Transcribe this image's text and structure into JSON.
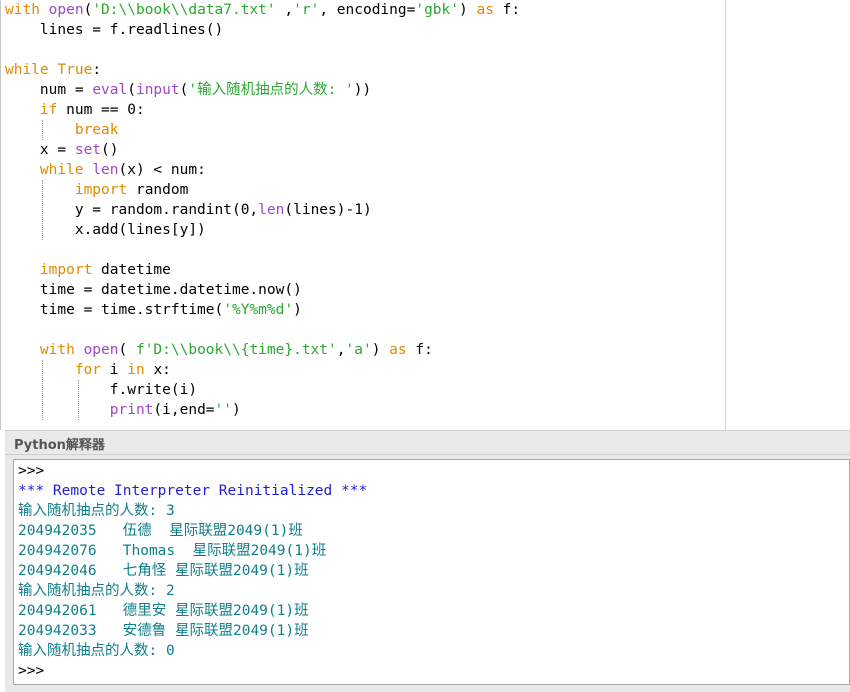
{
  "editor": {
    "lines": [
      {
        "segments": [
          {
            "t": "with",
            "c": "kw"
          },
          {
            "t": " "
          },
          {
            "t": "open",
            "c": "bi"
          },
          {
            "t": "("
          },
          {
            "t": "'D:\\\\book\\\\data7.txt'",
            "c": "str"
          },
          {
            "t": " ,"
          },
          {
            "t": "'r'",
            "c": "str"
          },
          {
            "t": ", encoding="
          },
          {
            "t": "'gbk'",
            "c": "str"
          },
          {
            "t": ") "
          },
          {
            "t": "as",
            "c": "kw"
          },
          {
            "t": " f:"
          }
        ]
      },
      {
        "segments": [
          {
            "t": "    lines = f.readlines()"
          }
        ]
      },
      {
        "segments": [
          {
            "t": ""
          }
        ]
      },
      {
        "segments": [
          {
            "t": "while",
            "c": "kw"
          },
          {
            "t": " "
          },
          {
            "t": "True",
            "c": "kw"
          },
          {
            "t": ":"
          }
        ]
      },
      {
        "segments": [
          {
            "t": "    num = "
          },
          {
            "t": "eval",
            "c": "bi"
          },
          {
            "t": "("
          },
          {
            "t": "input",
            "c": "bi"
          },
          {
            "t": "("
          },
          {
            "t": "'输入随机抽点的人数: '",
            "c": "str"
          },
          {
            "t": "))"
          }
        ]
      },
      {
        "segments": [
          {
            "t": "    "
          },
          {
            "t": "if",
            "c": "kw"
          },
          {
            "t": " num == 0:"
          }
        ]
      },
      {
        "segments": [
          {
            "t": "        "
          },
          {
            "t": "break",
            "c": "kw"
          }
        ]
      },
      {
        "segments": [
          {
            "t": "    x = "
          },
          {
            "t": "set",
            "c": "bi"
          },
          {
            "t": "()"
          }
        ]
      },
      {
        "segments": [
          {
            "t": "    "
          },
          {
            "t": "while",
            "c": "kw"
          },
          {
            "t": " "
          },
          {
            "t": "len",
            "c": "bi"
          },
          {
            "t": "(x) < num:"
          }
        ]
      },
      {
        "segments": [
          {
            "t": "        "
          },
          {
            "t": "import",
            "c": "kw"
          },
          {
            "t": " random"
          }
        ]
      },
      {
        "segments": [
          {
            "t": "        y = random.randint(0,"
          },
          {
            "t": "len",
            "c": "bi"
          },
          {
            "t": "(lines)-1)"
          }
        ]
      },
      {
        "segments": [
          {
            "t": "        x.add(lines[y])"
          }
        ]
      },
      {
        "segments": [
          {
            "t": ""
          }
        ]
      },
      {
        "segments": [
          {
            "t": "    "
          },
          {
            "t": "import",
            "c": "kw"
          },
          {
            "t": " datetime"
          }
        ]
      },
      {
        "segments": [
          {
            "t": "    time = datetime.datetime.now()"
          }
        ]
      },
      {
        "segments": [
          {
            "t": "    time = time.strftime("
          },
          {
            "t": "'%Y%m%d'",
            "c": "str"
          },
          {
            "t": ")"
          }
        ]
      },
      {
        "segments": [
          {
            "t": ""
          }
        ]
      },
      {
        "segments": [
          {
            "t": "    "
          },
          {
            "t": "with",
            "c": "kw"
          },
          {
            "t": " "
          },
          {
            "t": "open",
            "c": "bi"
          },
          {
            "t": "( "
          },
          {
            "t": "f'D:\\\\book\\\\{time}.txt'",
            "c": "str"
          },
          {
            "t": ","
          },
          {
            "t": "'a'",
            "c": "str"
          },
          {
            "t": ") "
          },
          {
            "t": "as",
            "c": "kw"
          },
          {
            "t": " f:"
          }
        ]
      },
      {
        "segments": [
          {
            "t": "        "
          },
          {
            "t": "for",
            "c": "kw"
          },
          {
            "t": " i "
          },
          {
            "t": "in",
            "c": "kw"
          },
          {
            "t": " x:"
          }
        ]
      },
      {
        "segments": [
          {
            "t": "            f.write(i)"
          }
        ]
      },
      {
        "segments": [
          {
            "t": "            "
          },
          {
            "t": "print",
            "c": "bi"
          },
          {
            "t": "(i,end="
          },
          {
            "t": "''",
            "c": "str"
          },
          {
            "t": ")"
          }
        ]
      }
    ]
  },
  "interpreter": {
    "title": "Python解释器",
    "lines": [
      {
        "text": ">>>",
        "style": "prompt"
      },
      {
        "text": "*** Remote Interpreter Reinitialized ***",
        "style": "blue"
      },
      {
        "text": "输入随机抽点的人数: 3",
        "style": "teal"
      },
      {
        "text": "204942035   伍德  星际联盟2049(1)班",
        "style": "teal"
      },
      {
        "text": "204942076   Thomas  星际联盟2049(1)班",
        "style": "teal"
      },
      {
        "text": "204942046   七角怪 星际联盟2049(1)班",
        "style": "teal"
      },
      {
        "text": "输入随机抽点的人数: 2",
        "style": "teal"
      },
      {
        "text": "204942061   德里安 星际联盟2049(1)班",
        "style": "teal"
      },
      {
        "text": "204942033   安德鲁 星际联盟2049(1)班",
        "style": "teal"
      },
      {
        "text": "输入随机抽点的人数: 0",
        "style": "teal"
      },
      {
        "text": ">>>",
        "style": "prompt"
      }
    ]
  },
  "colors": {
    "keyword": "#e08a00",
    "builtin": "#9e46c7",
    "string": "#2aa830",
    "console_blue": "#1f1fd1",
    "console_teal": "#0f7f8a"
  }
}
